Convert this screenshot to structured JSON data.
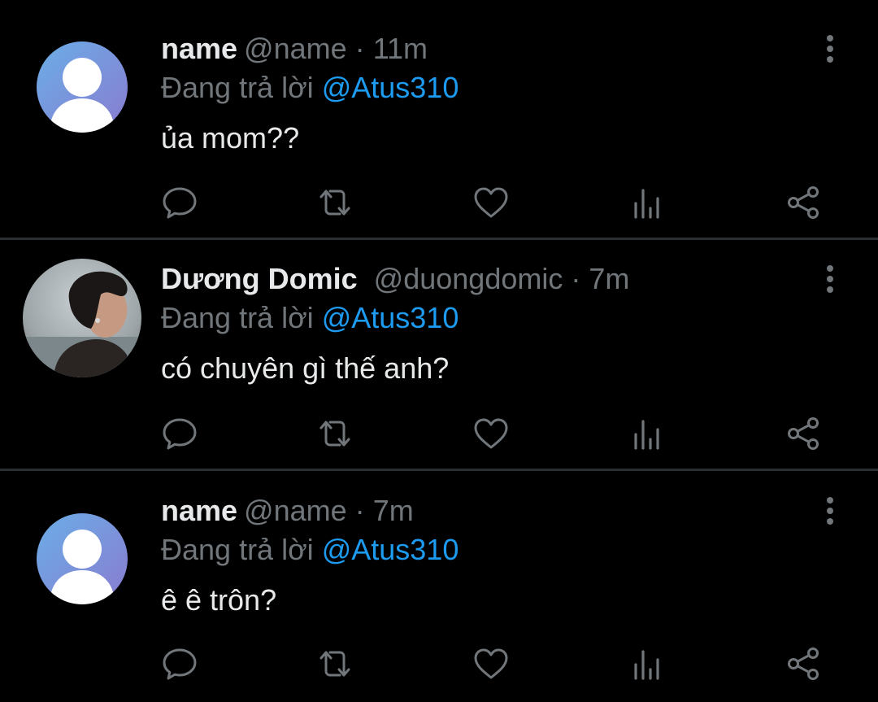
{
  "colors": {
    "background": "#000000",
    "text_primary": "#e7e9ea",
    "text_secondary": "#71767b",
    "accent": "#1d9bf0",
    "divider": "#2a2d31"
  },
  "tweets": [
    {
      "display_name": "name",
      "handle": "@name",
      "separator": "·",
      "time": "11m",
      "reply_prefix": "Đang trả lời",
      "reply_to": "@Atus310",
      "text": "ủa mom??",
      "avatar": "default-avatar-icon"
    },
    {
      "display_name": "Dương Domic",
      "handle": "@duongdomic",
      "separator": "·",
      "time": "7m",
      "reply_prefix": "Đang trả lời",
      "reply_to": "@Atus310",
      "text": "có chuyên gì thế anh?",
      "avatar": "profile-photo"
    },
    {
      "display_name": "name",
      "handle": "@name",
      "separator": "·",
      "time": "7m",
      "reply_prefix": "Đang trả lời",
      "reply_to": "@Atus310",
      "text": "ê ê trôn?",
      "avatar": "default-avatar-icon"
    }
  ],
  "action_icons": [
    "reply-icon",
    "retweet-icon",
    "like-icon",
    "views-icon",
    "share-icon"
  ],
  "more_icon": "more-vertical-icon"
}
